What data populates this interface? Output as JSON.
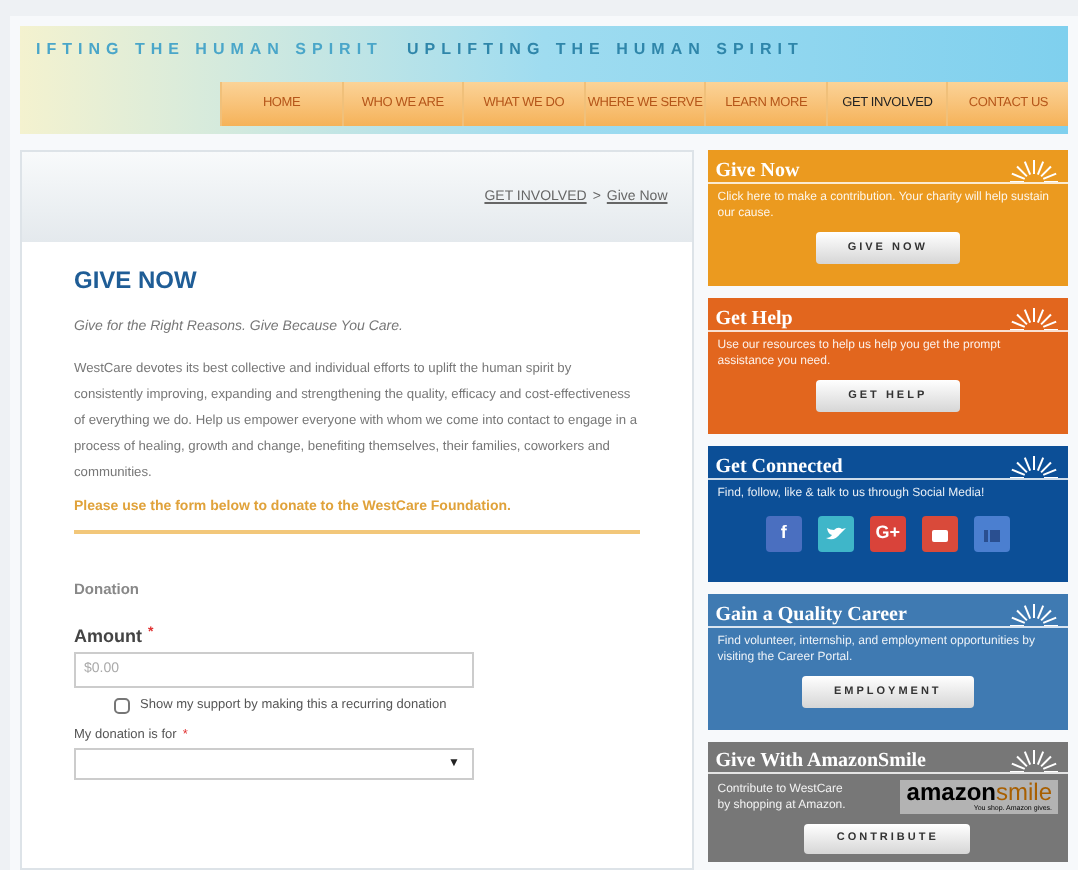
{
  "banner": {
    "taglines": [
      "IFTING THE HUMAN SPIRIT",
      "UPLIFTING THE HUMAN SPIRIT"
    ]
  },
  "nav": [
    {
      "label": "HOME",
      "selected": false
    },
    {
      "label": "WHO WE ARE",
      "selected": false
    },
    {
      "label": "WHAT WE DO",
      "selected": false
    },
    {
      "label": "WHERE WE SERVE",
      "selected": false
    },
    {
      "label": "LEARN MORE",
      "selected": false
    },
    {
      "label": "GET INVOLVED",
      "selected": true
    },
    {
      "label": "CONTACT US",
      "selected": false
    }
  ],
  "breadcrumb": [
    "GET INVOLVED",
    ">",
    "Give Now"
  ],
  "main": {
    "heading": "GIVE NOW",
    "tagline": "Give for the Right Reasons. Give Because You Care.",
    "body": "WestCare devotes its best collective and individual efforts to uplift the human spirit by consistently improving, expanding and strengthening the quality, efficacy and cost-effectiveness of everything we do. Help us empower everyone with whom we come into contact to engage in a process of healing, growth and change, benefiting themselves, their families, coworkers and communities.",
    "notice": "Please use the form below to donate to the WestCare Foundation."
  },
  "form": {
    "section": "Donation",
    "amount": {
      "label": "Amount",
      "required": "*",
      "placeholder": "$0.00"
    },
    "recurring": {
      "label": "Show my support by making this a recurring donation",
      "checked": false
    },
    "donation_for": {
      "label": "My donation is for",
      "required": "*",
      "caret": "▼"
    }
  },
  "sidebar": [
    {
      "kind": "button",
      "title": "Give Now",
      "color": "#eb9a1f",
      "text": "Click here to make a contribution. Your charity will help sustain our cause.",
      "button": "GIVE NOW"
    },
    {
      "kind": "button",
      "title": "Get Help",
      "color": "#e2661e",
      "text": "Use our resources to help us help you get the prompt assistance you need.",
      "button": "GET HELP"
    },
    {
      "kind": "social",
      "title": "Get Connected",
      "color": "#0c4f97",
      "text": "Find, follow, like & talk to us through Social Media!",
      "glyphs": {
        "facebook": "f",
        "google_plus": "G+"
      }
    },
    {
      "kind": "button",
      "title": "Gain a Quality Career",
      "color": "#3f7ab2",
      "text": "Find volunteer, internship, and employment opportunities by visiting the Career Portal.",
      "button": "EMPLOYMENT"
    },
    {
      "kind": "amazon",
      "title": "Give With AmazonSmile",
      "color": "#777777",
      "text": "Contribute to WestCare by shopping at Amazon.",
      "logo": [
        "amazon",
        "smile"
      ],
      "logo_caption": "You shop. Amazon gives.",
      "button": "CONTRIBUTE"
    }
  ]
}
